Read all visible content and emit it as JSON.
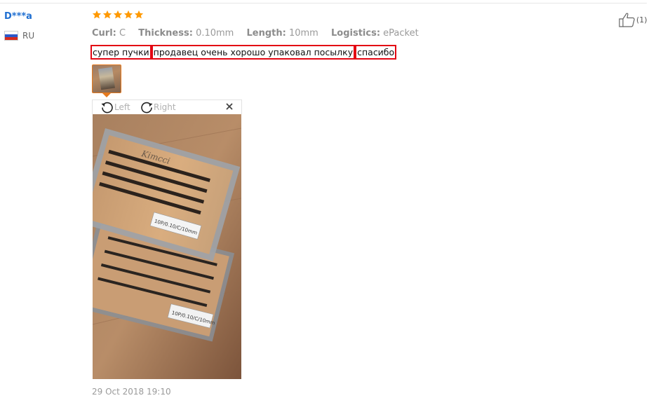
{
  "review": {
    "user_name": "D***a",
    "country_code": "RU",
    "rating": 5,
    "attributes": [
      {
        "name": "Curl:",
        "value": "C"
      },
      {
        "name": "Thickness:",
        "value": "0.10mm"
      },
      {
        "name": "Length:",
        "value": "10mm"
      },
      {
        "name": "Logistics:",
        "value": "ePacket"
      }
    ],
    "text_segments": [
      "супер пучки",
      "продавец очень хорошо упаковал посылку",
      "спасибо"
    ],
    "date": "29 Oct 2018 19:10",
    "helpful_count": "(1)"
  },
  "viewer": {
    "rotate_left_label": "Left",
    "rotate_right_label": "Right",
    "photo": {
      "brand": "Kimcci",
      "box_label": "10P/0.10/C/10mm"
    }
  },
  "icons": {
    "star": "star-icon",
    "flag": "russia-flag-icon",
    "rotate_left": "rotate-left-icon",
    "rotate_right": "rotate-right-icon",
    "close": "close-icon",
    "thumbs_up": "thumbs-up-icon"
  },
  "colors": {
    "star": "#ff9900",
    "user_name": "#1f6fd1",
    "highlight_border": "#e30613",
    "thumb_border": "#e5791e"
  }
}
